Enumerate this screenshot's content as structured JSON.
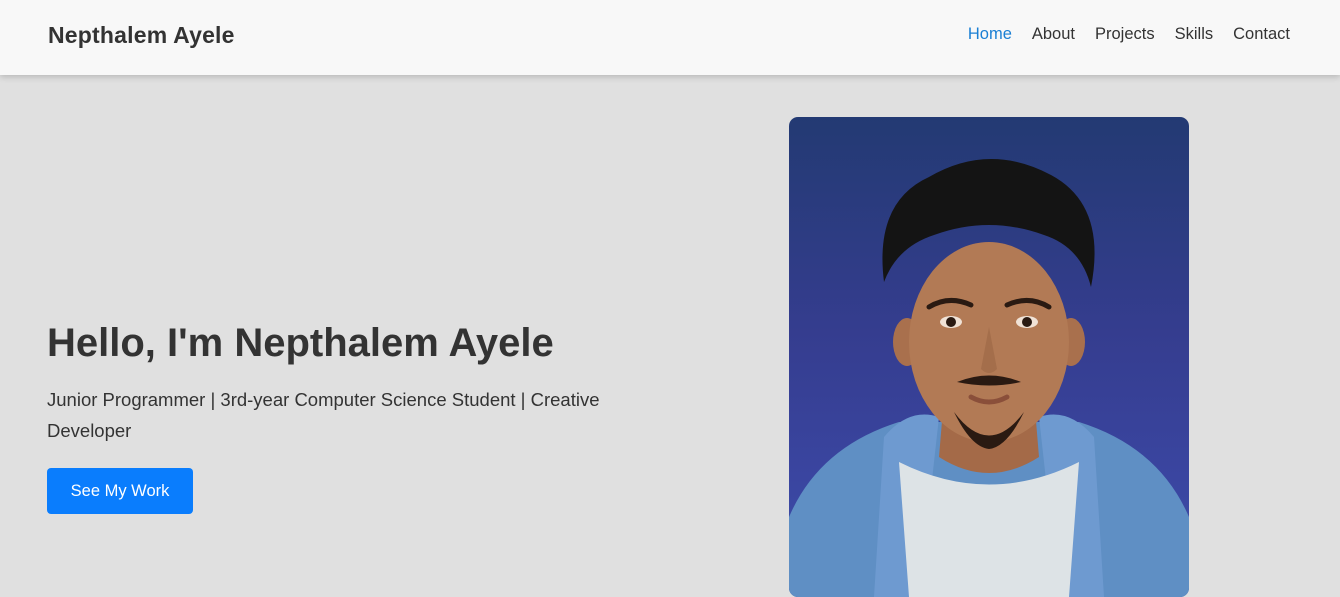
{
  "header": {
    "brand": "Nepthalem Ayele",
    "nav": [
      {
        "label": "Home",
        "active": true
      },
      {
        "label": "About",
        "active": false
      },
      {
        "label": "Projects",
        "active": false
      },
      {
        "label": "Skills",
        "active": false
      },
      {
        "label": "Contact",
        "active": false
      }
    ]
  },
  "hero": {
    "title": "Hello, I'm Nepthalem Ayele",
    "subtitle": "Junior Programmer | 3rd-year Computer Science Student | Creative Developer",
    "cta_label": "See My Work"
  },
  "colors": {
    "accent": "#0a7dfd",
    "active_link": "#1a7fd4",
    "background": "#e0e0e0",
    "portrait_background": "#3a45a0"
  }
}
